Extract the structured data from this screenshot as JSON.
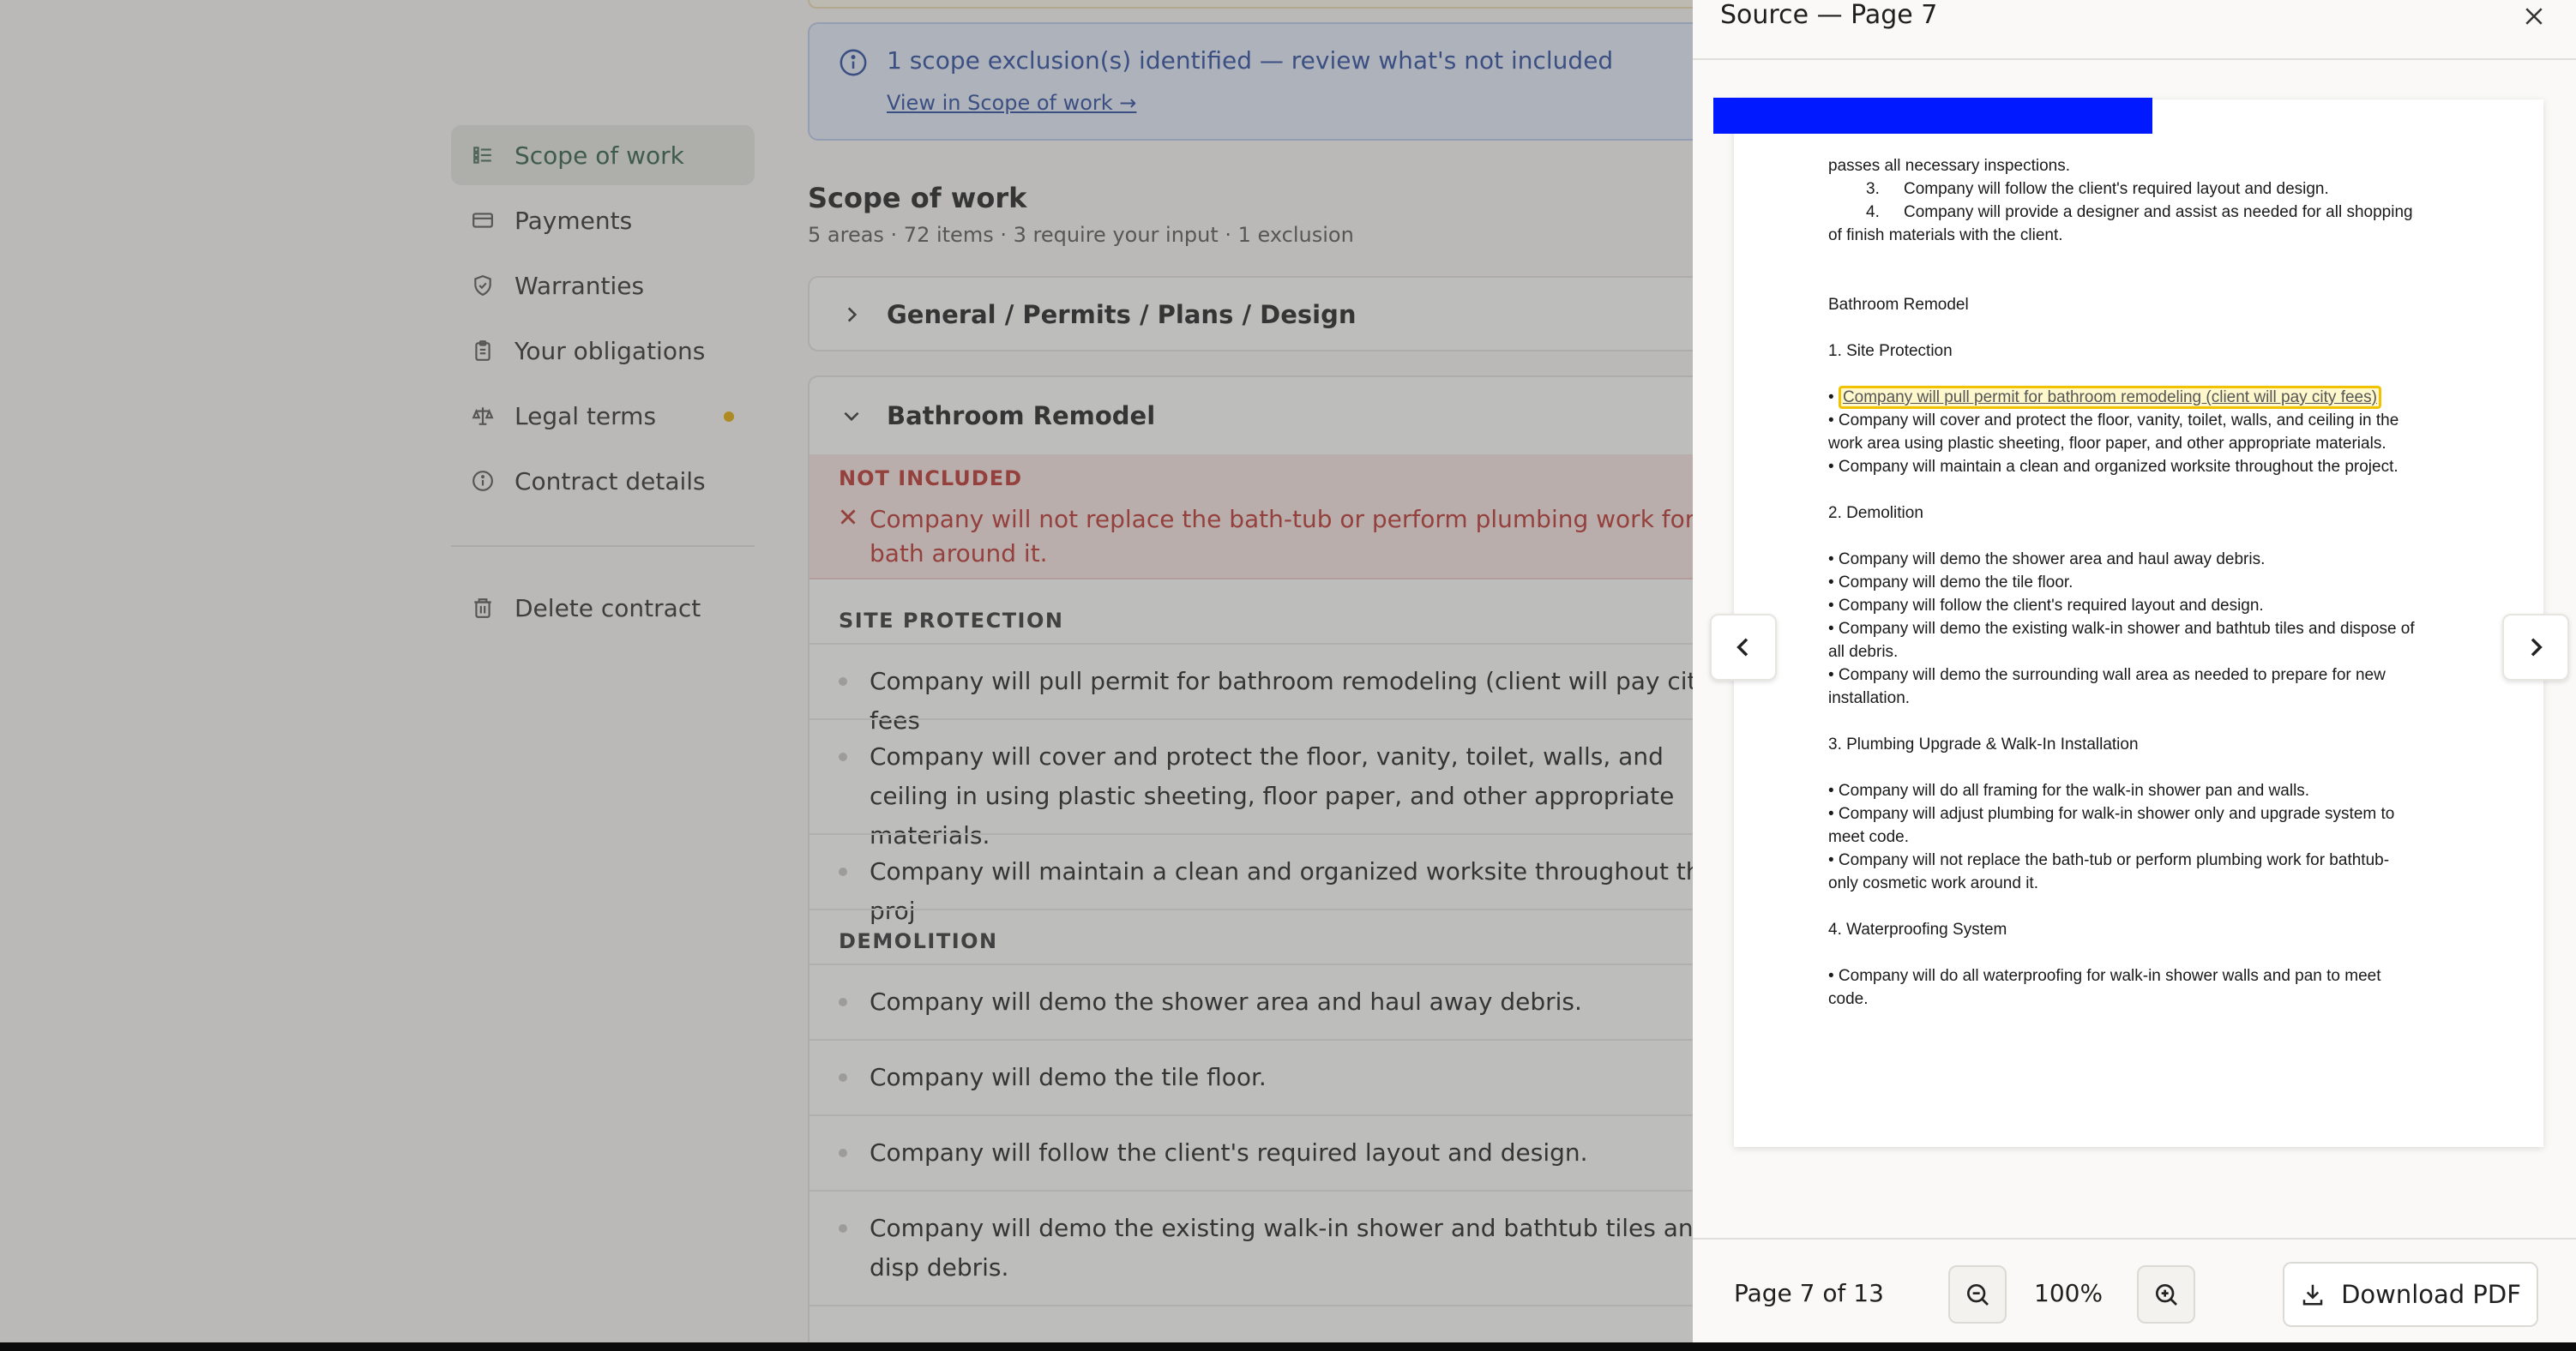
{
  "sidebar": {
    "items": [
      {
        "label": "Scope of work",
        "icon": "list-icon",
        "active": true
      },
      {
        "label": "Payments",
        "icon": "credit-card-icon"
      },
      {
        "label": "Warranties",
        "icon": "shield-check-icon"
      },
      {
        "label": "Your obligations",
        "icon": "clipboard-icon"
      },
      {
        "label": "Legal terms",
        "icon": "scale-icon",
        "badge": true
      },
      {
        "label": "Contract details",
        "icon": "info-icon"
      }
    ],
    "delete_label": "Delete contract"
  },
  "main": {
    "info_banner": {
      "text": "1 scope exclusion(s) identified — review what's not included",
      "link": "View in Scope of work →"
    },
    "section_title": "Scope of work",
    "section_summary": "5 areas · 72 items · 3 require your input · 1 exclusion",
    "areas": [
      {
        "title": "General / Permits / Plans / Design",
        "expanded": false
      },
      {
        "title": "Bathroom Remodel",
        "expanded": true
      }
    ],
    "exclusion": {
      "label": "NOT INCLUDED",
      "text": "Company will not replace the bath-tub or perform plumbing work for bath around it."
    },
    "groups": [
      {
        "label": "SITE PROTECTION",
        "items": [
          "Company will pull permit for bathroom remodeling (client will pay city fees",
          "Company will cover and protect the floor, vanity, toilet, walls, and ceiling in using plastic sheeting, floor paper, and other appropriate materials.",
          "Company will maintain a clean and organized worksite throughout the proj"
        ]
      },
      {
        "label": "DEMOLITION",
        "items": [
          "Company will demo the shower area and haul away debris.",
          "Company will demo the tile floor.",
          "Company will follow the client's required layout and design.",
          "Company will demo the existing walk-in shower and bathtub tiles and disp debris."
        ]
      }
    ]
  },
  "panel": {
    "title": "Source — Page 7",
    "page_indicator": "Page 7 of 13",
    "zoom": "100%",
    "download_label": "Download PDF",
    "highlight_color": "#f2c200",
    "redaction_color": "#0019ff",
    "doc": {
      "l1": "passes all necessary inspections.",
      "l2n": "3.",
      "l2": "Company will follow the client's required layout and design.",
      "l3n": "4.",
      "l3a": "Company will provide a designer and assist as needed for all shopping",
      "l3b": "of finish materials with the client.",
      "h1": "Bathroom Remodel",
      "s1": "1. Site Protection",
      "s1hl": "Company will pull permit for bathroom remodeling (client will pay city fees)",
      "s1b": "• Company will cover and protect the floor, vanity, toilet, walls, and ceiling in the",
      "s1b2": "work area using plastic sheeting, floor paper, and other appropriate materials.",
      "s1c": "• Company will maintain a clean and organized worksite throughout the project.",
      "s2": "2. Demolition",
      "s2a": "• Company will demo the shower area and haul away debris.",
      "s2b": "• Company will demo the tile floor.",
      "s2c": "• Company will follow the client's required layout and design.",
      "s2d": "• Company will demo the existing walk-in shower and bathtub tiles and dispose of",
      "s2d2": "all debris.",
      "s2e": "• Company will demo the surrounding wall area as needed to prepare for new",
      "s2e2": "installation.",
      "s3": "3. Plumbing Upgrade & Walk-In Installation",
      "s3a": "• Company will do all framing for the walk-in shower pan and walls.",
      "s3b": "• Company will adjust plumbing for walk-in shower only and upgrade system to",
      "s3b2": "meet code.",
      "s3c": "• Company will not replace the bath-tub or perform plumbing work for bathtub-",
      "s3c2": "only cosmetic work around it.",
      "s4": "4. Waterproofing System",
      "s4a": "• Company will do all waterproofing for walk-in shower walls and pan to meet",
      "s4a2": "code."
    }
  }
}
